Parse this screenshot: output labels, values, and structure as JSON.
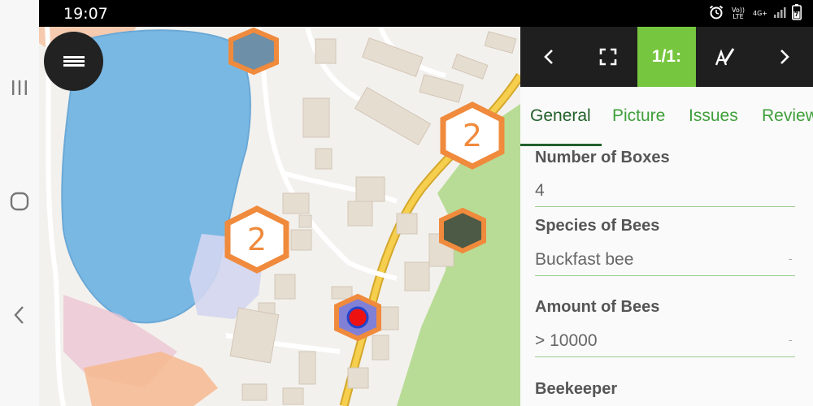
{
  "status_bar": {
    "time": "19:07",
    "network_label": "Vo)) LTE",
    "network_type": "4G+",
    "icons": [
      "alarm-icon",
      "signal-icon",
      "battery-icon"
    ]
  },
  "nav_bar": {
    "buttons": [
      "recent-apps-icon",
      "home-icon",
      "back-icon"
    ]
  },
  "map": {
    "menu_icon": "hamburger-menu-icon",
    "clusters": [
      {
        "count": "2",
        "color": "#f08a3c"
      },
      {
        "count": "2",
        "color": "#f08a3c"
      }
    ],
    "colors": {
      "lake": "#7ab8e4",
      "forest": "#b8dc96",
      "road": "#f5cf4d",
      "marker_border": "#f08a3c",
      "selected_marker": "#ee1111"
    }
  },
  "panel": {
    "toolbar": {
      "prev_icon": "chevron-left-icon",
      "fullscreen_icon": "fullscreen-icon",
      "page_indicator": "1/1:",
      "edit_icon": "edit-text-icon",
      "next_icon": "chevron-right-icon",
      "accent": "#77c63f"
    },
    "tabs": [
      "General",
      "Picture",
      "Issues",
      "Review"
    ],
    "active_tab": "General",
    "fields": {
      "boxes_label": "Number of Boxes",
      "boxes_value": "4",
      "species_label": "Species of Bees",
      "species_value": "Buckfast bee",
      "amount_label": "Amount of Bees",
      "amount_value": "> 10000",
      "beekeeper_label": "Beekeeper"
    }
  }
}
